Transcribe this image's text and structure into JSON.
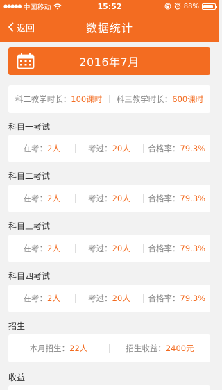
{
  "status": {
    "carrier": "中国移动",
    "time": "15:52",
    "battery_text": "88%",
    "battery_level": 0.88
  },
  "nav": {
    "back_label": "返回",
    "title": "数据统计"
  },
  "month": "2016年7月",
  "teaching": {
    "k2_label": "科二教学时长：",
    "k2_value": "100课时",
    "k3_label": "科三教学时长：",
    "k3_value": "600课时"
  },
  "exams": [
    {
      "title": "科目一考试",
      "taking_label": "在考：",
      "taking_value": "2人",
      "passed_label": "考过：",
      "passed_value": "20人",
      "rate_label": "合格率：",
      "rate_value": "79.3%"
    },
    {
      "title": "科目二考试",
      "taking_label": "在考：",
      "taking_value": "2人",
      "passed_label": "考过：",
      "passed_value": "20人",
      "rate_label": "合格率：",
      "rate_value": "79.3%"
    },
    {
      "title": "科目三考试",
      "taking_label": "在考：",
      "taking_value": "2人",
      "passed_label": "考过：",
      "passed_value": "20人",
      "rate_label": "合格率：",
      "rate_value": "79.3%"
    },
    {
      "title": "科目四考试",
      "taking_label": "在考：",
      "taking_value": "2人",
      "passed_label": "考过：",
      "passed_value": "20人",
      "rate_label": "合格率：",
      "rate_value": "79.3%"
    }
  ],
  "enroll": {
    "title": "招生",
    "month_label": "本月招生：",
    "month_value": "22人",
    "income_label": "招生收益：",
    "income_value": "2400元"
  },
  "income": {
    "title": "收益"
  },
  "colors": {
    "accent": "#f36c21",
    "background": "#f2f2f2"
  },
  "icons": {
    "back": "chevron-left-icon",
    "calendar": "calendar-icon",
    "wifi": "wifi-icon",
    "alarm": "alarm-icon",
    "lock": "orientation-lock-icon",
    "battery": "battery-icon"
  }
}
